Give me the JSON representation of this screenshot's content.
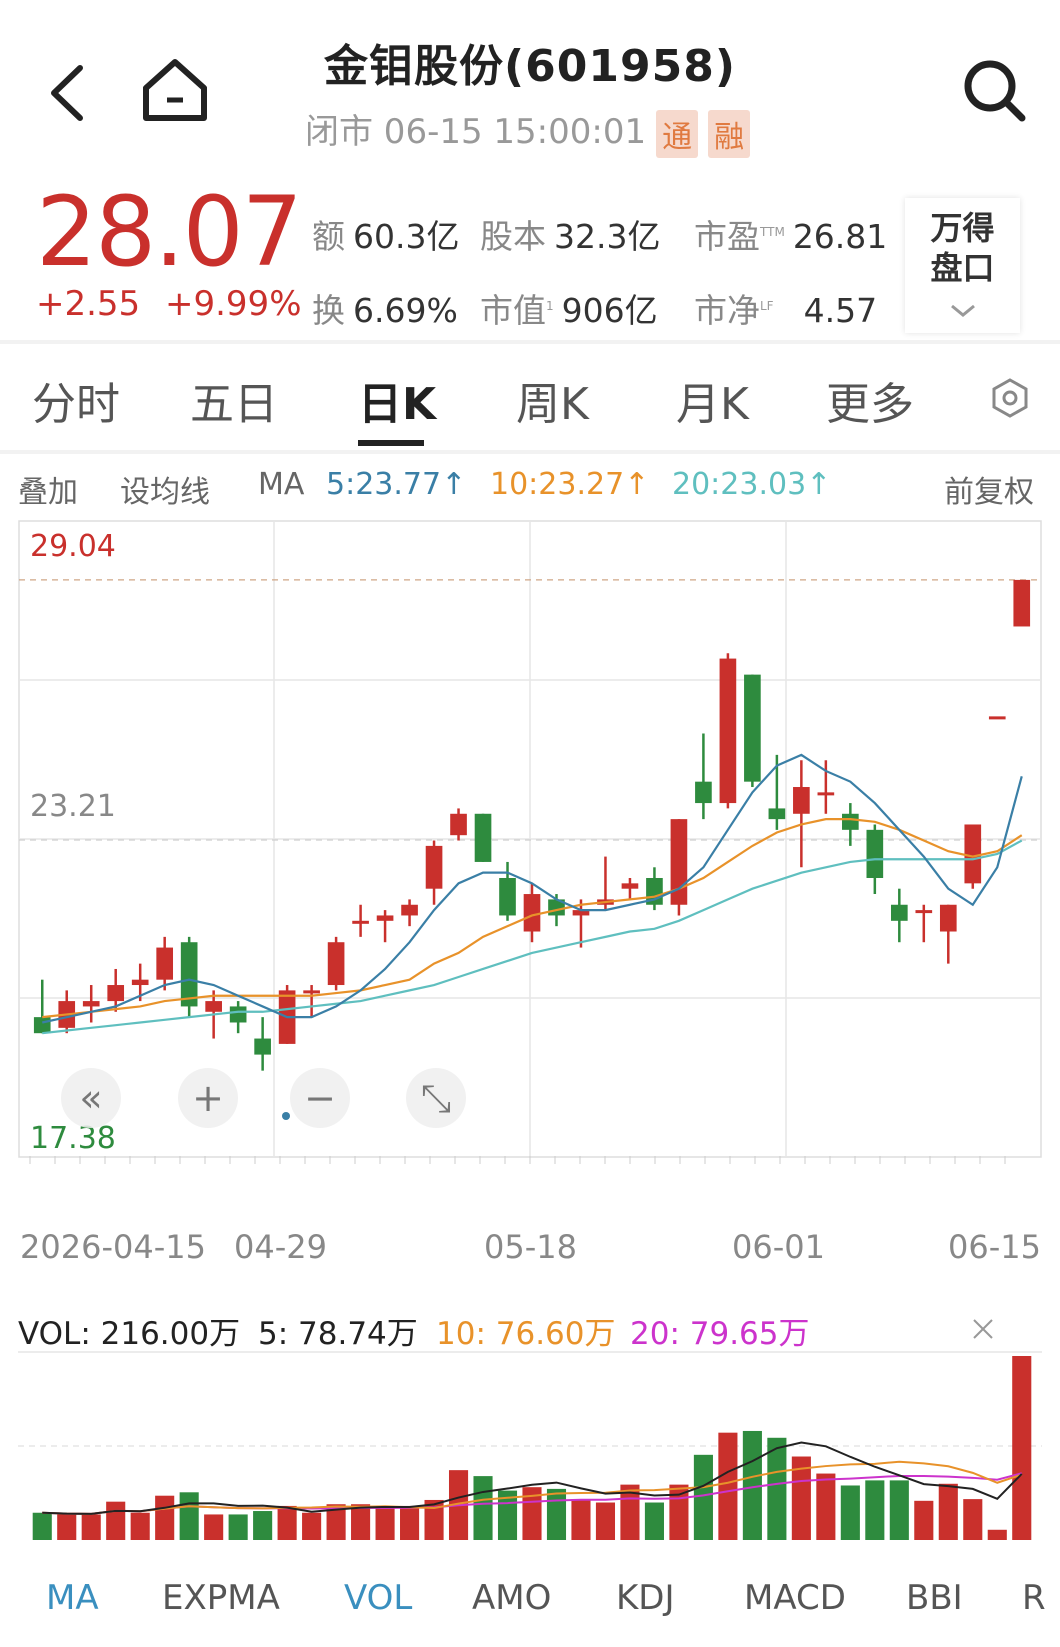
{
  "header": {
    "title": "金钼股份(601958)",
    "status": "闭市 06-15 15:00:01",
    "badge1": "通",
    "badge2": "融"
  },
  "quote": {
    "price": "28.07",
    "change": "+2.55",
    "change_pct": "+9.99%",
    "amount_label": "额",
    "amount": "60.3亿",
    "capital_label": "股本",
    "capital": "32.3亿",
    "pe_label": "市盈",
    "pe_sup": "TTM",
    "pe": "26.81",
    "turnover_label": "换",
    "turnover": "6.69%",
    "mktcap_label": "市值",
    "mktcap_sup": "1",
    "mktcap": "906亿",
    "pb_label": "市净",
    "pb_sup": "LF",
    "pb": "4.57",
    "wind_line1": "万得",
    "wind_line2": "盘口"
  },
  "tabs": [
    "分时",
    "五日",
    "日K",
    "周K",
    "月K",
    "更多"
  ],
  "active_tab": "日K",
  "ma_row": {
    "overlay": "叠加",
    "set_ma": "设均线",
    "ma": "MA",
    "ma5": "5:23.77↑",
    "ma10": "10:23.27↑",
    "ma20": "20:23.03↑",
    "adjust": "前复权"
  },
  "colors": {
    "up": "#c9302c",
    "down": "#2e8b3e",
    "ma5": "#3a7fa6",
    "ma10": "#e8922a",
    "ma20": "#5fbfbf",
    "ma20vol": "#cc33cc"
  },
  "chart_data": {
    "type": "candlestick",
    "ylim": [
      17.38,
      29.04
    ],
    "y_labels": [
      "29.04",
      "23.21",
      "17.38"
    ],
    "x_labels": [
      "2026-04-15",
      "04-29",
      "05-18",
      "06-01",
      "06-15"
    ],
    "candles": [
      {
        "o": 19.9,
        "h": 20.6,
        "l": 19.6,
        "c": 19.6
      },
      {
        "o": 19.7,
        "h": 20.4,
        "l": 19.6,
        "c": 20.2
      },
      {
        "o": 20.1,
        "h": 20.5,
        "l": 19.8,
        "c": 20.2
      },
      {
        "o": 20.2,
        "h": 20.8,
        "l": 20.0,
        "c": 20.5
      },
      {
        "o": 20.5,
        "h": 20.9,
        "l": 20.2,
        "c": 20.6
      },
      {
        "o": 20.6,
        "h": 21.4,
        "l": 20.4,
        "c": 21.2
      },
      {
        "o": 21.3,
        "h": 21.4,
        "l": 19.9,
        "c": 20.1
      },
      {
        "o": 20.0,
        "h": 20.4,
        "l": 19.5,
        "c": 20.2
      },
      {
        "o": 20.1,
        "h": 20.2,
        "l": 19.6,
        "c": 19.8
      },
      {
        "o": 19.5,
        "h": 19.9,
        "l": 18.9,
        "c": 19.2
      },
      {
        "o": 19.4,
        "h": 20.5,
        "l": 19.4,
        "c": 20.4
      },
      {
        "o": 20.4,
        "h": 20.5,
        "l": 19.9,
        "c": 20.4
      },
      {
        "o": 20.5,
        "h": 21.4,
        "l": 20.4,
        "c": 21.3
      },
      {
        "o": 21.7,
        "h": 22.0,
        "l": 21.4,
        "c": 21.7
      },
      {
        "o": 21.7,
        "h": 21.9,
        "l": 21.3,
        "c": 21.8
      },
      {
        "o": 21.8,
        "h": 22.1,
        "l": 21.6,
        "c": 22.0
      },
      {
        "o": 22.3,
        "h": 23.2,
        "l": 22.0,
        "c": 23.1
      },
      {
        "o": 23.3,
        "h": 23.8,
        "l": 23.2,
        "c": 23.7
      },
      {
        "o": 23.7,
        "h": 23.7,
        "l": 22.8,
        "c": 22.8
      },
      {
        "o": 22.5,
        "h": 22.8,
        "l": 21.7,
        "c": 21.8
      },
      {
        "o": 21.5,
        "h": 22.4,
        "l": 21.3,
        "c": 22.2
      },
      {
        "o": 22.1,
        "h": 22.2,
        "l": 21.6,
        "c": 21.8
      },
      {
        "o": 21.8,
        "h": 22.1,
        "l": 21.2,
        "c": 21.9
      },
      {
        "o": 22.0,
        "h": 22.9,
        "l": 21.9,
        "c": 22.1
      },
      {
        "o": 22.3,
        "h": 22.5,
        "l": 22.1,
        "c": 22.4
      },
      {
        "o": 22.5,
        "h": 22.7,
        "l": 21.9,
        "c": 22.0
      },
      {
        "o": 22.0,
        "h": 23.6,
        "l": 21.8,
        "c": 23.6
      },
      {
        "o": 24.3,
        "h": 25.2,
        "l": 23.6,
        "c": 23.9
      },
      {
        "o": 23.9,
        "h": 26.7,
        "l": 23.8,
        "c": 26.6
      },
      {
        "o": 26.3,
        "h": 26.3,
        "l": 24.2,
        "c": 24.3
      },
      {
        "o": 23.8,
        "h": 24.8,
        "l": 23.4,
        "c": 23.6
      },
      {
        "o": 23.7,
        "h": 24.7,
        "l": 22.7,
        "c": 24.2
      },
      {
        "o": 24.1,
        "h": 24.7,
        "l": 23.7,
        "c": 24.1
      },
      {
        "o": 23.7,
        "h": 23.9,
        "l": 23.1,
        "c": 23.4
      },
      {
        "o": 23.4,
        "h": 23.5,
        "l": 22.2,
        "c": 22.5
      },
      {
        "o": 22.0,
        "h": 22.3,
        "l": 21.3,
        "c": 21.7
      },
      {
        "o": 21.9,
        "h": 22.0,
        "l": 21.3,
        "c": 21.9
      },
      {
        "o": 21.5,
        "h": 22.0,
        "l": 20.9,
        "c": 22.0
      },
      {
        "o": 22.4,
        "h": 23.5,
        "l": 22.3,
        "c": 23.5
      },
      {
        "o": 25.52,
        "h": 25.52,
        "l": 25.52,
        "c": 25.52
      },
      {
        "o": 27.2,
        "h": 28.07,
        "l": 27.3,
        "c": 28.07
      }
    ],
    "ma5": [
      19.8,
      19.9,
      20.0,
      20.1,
      20.3,
      20.5,
      20.6,
      20.5,
      20.3,
      20.1,
      19.9,
      19.9,
      20.1,
      20.4,
      20.8,
      21.3,
      21.9,
      22.4,
      22.6,
      22.6,
      22.4,
      22.1,
      21.9,
      21.9,
      22.0,
      22.1,
      22.3,
      22.7,
      23.4,
      24.1,
      24.6,
      24.8,
      24.5,
      24.3,
      23.9,
      23.4,
      22.9,
      22.3,
      22.0,
      22.7,
      24.4
    ],
    "ma10": [
      19.9,
      19.95,
      20.0,
      20.05,
      20.1,
      20.2,
      20.25,
      20.3,
      20.3,
      20.3,
      20.3,
      20.3,
      20.35,
      20.4,
      20.5,
      20.6,
      20.9,
      21.1,
      21.4,
      21.6,
      21.8,
      21.9,
      22.0,
      22.05,
      22.1,
      22.15,
      22.3,
      22.5,
      22.8,
      23.1,
      23.35,
      23.5,
      23.6,
      23.6,
      23.55,
      23.4,
      23.2,
      23.0,
      22.9,
      23.0,
      23.3
    ],
    "ma20": [
      19.6,
      19.65,
      19.7,
      19.75,
      19.8,
      19.85,
      19.9,
      19.95,
      20.0,
      20.0,
      20.05,
      20.1,
      20.15,
      20.2,
      20.3,
      20.4,
      20.5,
      20.65,
      20.8,
      20.95,
      21.1,
      21.2,
      21.3,
      21.4,
      21.5,
      21.55,
      21.7,
      21.9,
      22.1,
      22.3,
      22.45,
      22.6,
      22.7,
      22.8,
      22.85,
      22.85,
      22.85,
      22.85,
      22.85,
      22.95,
      23.2
    ]
  },
  "vol_row": {
    "vol": "VOL: 216.00万",
    "v5": "5: 78.74万",
    "v10": "10: 76.60万",
    "v20": "20: 79.65万"
  },
  "vol_data": {
    "max": 216,
    "bars": [
      32,
      30,
      30,
      45,
      32,
      52,
      56,
      30,
      30,
      34,
      40,
      32,
      42,
      42,
      38,
      40,
      47,
      82,
      75,
      58,
      62,
      60,
      48,
      44,
      65,
      44,
      65,
      100,
      126,
      128,
      120,
      98,
      78,
      64,
      70,
      70,
      46,
      66,
      48,
      12,
      216
    ]
  },
  "bottom_tabs": [
    "MA",
    "EXPMA",
    "VOL",
    "AMO",
    "KDJ",
    "MACD",
    "BBI",
    "R"
  ]
}
